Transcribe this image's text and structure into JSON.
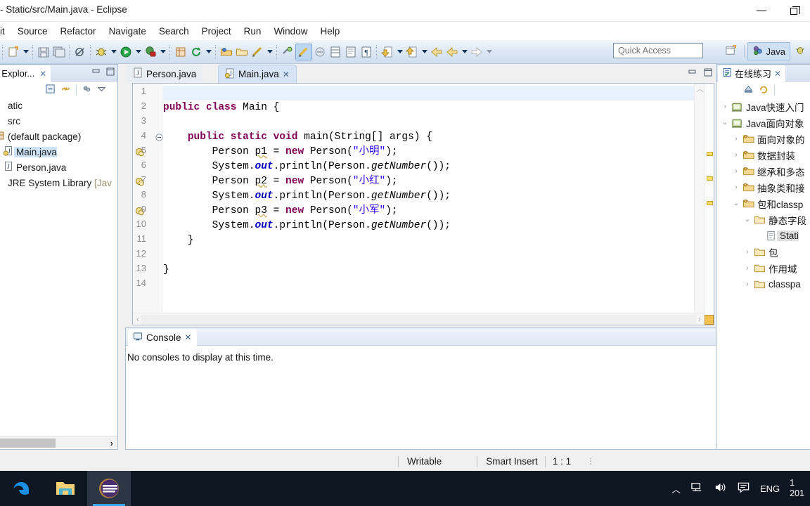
{
  "window": {
    "title": "- Static/src/Main.java - Eclipse",
    "minimize_label": "Minimize",
    "restore_label": "Restore"
  },
  "menubar": {
    "items": [
      {
        "label": "it"
      },
      {
        "label": "Source"
      },
      {
        "label": "Refactor"
      },
      {
        "label": "Navigate"
      },
      {
        "label": "Search"
      },
      {
        "label": "Project"
      },
      {
        "label": "Run"
      },
      {
        "label": "Window"
      },
      {
        "label": "Help"
      }
    ]
  },
  "toolbar": {
    "quick_access_placeholder": "Quick Access",
    "perspective": {
      "open_perspective_label": "",
      "java_label": "Java"
    }
  },
  "package_explorer": {
    "tab_label": "age Explor...",
    "close_label": "✕",
    "tree": [
      {
        "label": "atic",
        "indent": 0,
        "twisty": "",
        "icon": "project-icon",
        "selected": false
      },
      {
        "label": "src",
        "indent": 0,
        "twisty": "",
        "icon": "source-folder-icon",
        "selected": false
      },
      {
        "label": "(default package)",
        "indent": 0,
        "twisty": "",
        "icon": "package-icon",
        "selected": false
      },
      {
        "label": "Main.java",
        "indent": 1,
        "twisty": "›",
        "icon": "java-file-warning-icon",
        "selected": true
      },
      {
        "label": "Person.java",
        "indent": 1,
        "twisty": "›",
        "icon": "java-file-icon",
        "selected": false
      },
      {
        "label": "JRE System Library",
        "suffix": "[Jav",
        "indent": 0,
        "twisty": "",
        "icon": "library-icon",
        "selected": false
      }
    ]
  },
  "editor": {
    "tabs": [
      {
        "label": "Person.java",
        "active": false,
        "closable": false
      },
      {
        "label": "Main.java",
        "active": true,
        "closable": true,
        "close_label": "✕"
      }
    ],
    "lines": [
      {
        "num": "1",
        "warn": false,
        "fold": "",
        "tokens": []
      },
      {
        "num": "2",
        "warn": false,
        "fold": "",
        "tokens": [
          {
            "t": "public",
            "c": "k"
          },
          {
            "t": " ",
            "c": ""
          },
          {
            "t": "class",
            "c": "k"
          },
          {
            "t": " Main {",
            "c": ""
          }
        ]
      },
      {
        "num": "3",
        "warn": false,
        "fold": "",
        "tokens": []
      },
      {
        "num": "4",
        "warn": false,
        "fold": "⊖",
        "tokens": [
          {
            "t": "    ",
            "c": ""
          },
          {
            "t": "public",
            "c": "k"
          },
          {
            "t": " ",
            "c": ""
          },
          {
            "t": "static",
            "c": "k"
          },
          {
            "t": " ",
            "c": ""
          },
          {
            "t": "void",
            "c": "k"
          },
          {
            "t": " main(String[] args) {",
            "c": ""
          }
        ]
      },
      {
        "num": "5",
        "warn": true,
        "fold": "",
        "tokens": [
          {
            "t": "        Person ",
            "c": ""
          },
          {
            "t": "p1",
            "c": "sq"
          },
          {
            "t": " = ",
            "c": ""
          },
          {
            "t": "new",
            "c": "k"
          },
          {
            "t": " Person(",
            "c": ""
          },
          {
            "t": "\"小明\"",
            "c": "s"
          },
          {
            "t": ");",
            "c": ""
          }
        ]
      },
      {
        "num": "6",
        "warn": false,
        "fold": "",
        "tokens": [
          {
            "t": "        System.",
            "c": ""
          },
          {
            "t": "out",
            "c": "fld"
          },
          {
            "t": ".println(Person.",
            "c": ""
          },
          {
            "t": "getNumber",
            "c": "stat"
          },
          {
            "t": "());",
            "c": ""
          }
        ]
      },
      {
        "num": "7",
        "warn": true,
        "fold": "",
        "tokens": [
          {
            "t": "        Person ",
            "c": ""
          },
          {
            "t": "p2",
            "c": "sq"
          },
          {
            "t": " = ",
            "c": ""
          },
          {
            "t": "new",
            "c": "k"
          },
          {
            "t": " Person(",
            "c": ""
          },
          {
            "t": "\"小红\"",
            "c": "s"
          },
          {
            "t": ");",
            "c": ""
          }
        ]
      },
      {
        "num": "8",
        "warn": false,
        "fold": "",
        "tokens": [
          {
            "t": "        System.",
            "c": ""
          },
          {
            "t": "out",
            "c": "fld"
          },
          {
            "t": ".println(Person.",
            "c": ""
          },
          {
            "t": "getNumber",
            "c": "stat"
          },
          {
            "t": "());",
            "c": ""
          }
        ]
      },
      {
        "num": "9",
        "warn": true,
        "fold": "",
        "tokens": [
          {
            "t": "        Person ",
            "c": ""
          },
          {
            "t": "p3",
            "c": "sq"
          },
          {
            "t": " = ",
            "c": ""
          },
          {
            "t": "new",
            "c": "k"
          },
          {
            "t": " Person(",
            "c": ""
          },
          {
            "t": "\"小军\"",
            "c": "s"
          },
          {
            "t": ");",
            "c": ""
          }
        ]
      },
      {
        "num": "10",
        "warn": false,
        "fold": "",
        "tokens": [
          {
            "t": "        System.",
            "c": ""
          },
          {
            "t": "out",
            "c": "fld"
          },
          {
            "t": ".println(Person.",
            "c": ""
          },
          {
            "t": "getNumber",
            "c": "stat"
          },
          {
            "t": "());",
            "c": ""
          }
        ]
      },
      {
        "num": "11",
        "warn": false,
        "fold": "",
        "tokens": [
          {
            "t": "    }",
            "c": ""
          }
        ]
      },
      {
        "num": "12",
        "warn": false,
        "fold": "",
        "tokens": []
      },
      {
        "num": "13",
        "warn": false,
        "fold": "",
        "tokens": [
          {
            "t": "}",
            "c": ""
          }
        ]
      },
      {
        "num": "14",
        "warn": false,
        "fold": "",
        "tokens": []
      }
    ]
  },
  "console": {
    "tab_label": "Console",
    "close_label": "✕",
    "message": "No consoles to display at this time."
  },
  "right_view": {
    "tab_label": "在线练习",
    "close_label": "✕",
    "tree": [
      {
        "label": "Java快速入门",
        "indent": 0,
        "twisty": "›",
        "icon": "course-icon",
        "selected": false
      },
      {
        "label": "Java面向对象",
        "indent": 0,
        "twisty": "⌄",
        "icon": "course-open-icon",
        "selected": false
      },
      {
        "label": "面向对象的",
        "indent": 1,
        "twisty": "›",
        "icon": "chapter-icon",
        "selected": false
      },
      {
        "label": "数据封装",
        "indent": 1,
        "twisty": "›",
        "icon": "chapter-icon",
        "selected": false
      },
      {
        "label": "继承和多态",
        "indent": 1,
        "twisty": "›",
        "icon": "chapter-icon",
        "selected": false
      },
      {
        "label": "抽象类和接",
        "indent": 1,
        "twisty": "›",
        "icon": "chapter-icon",
        "selected": false
      },
      {
        "label": "包和classp",
        "indent": 1,
        "twisty": "⌄",
        "icon": "chapter-open-icon",
        "selected": false
      },
      {
        "label": "静态字段",
        "indent": 2,
        "twisty": "⌄",
        "icon": "folder-open-icon",
        "selected": false
      },
      {
        "label": "Stati",
        "indent": 3,
        "twisty": "",
        "icon": "exercise-icon",
        "selected": true
      },
      {
        "label": "包",
        "indent": 2,
        "twisty": "›",
        "icon": "folder-icon",
        "selected": false
      },
      {
        "label": "作用域",
        "indent": 2,
        "twisty": "›",
        "icon": "folder-icon",
        "selected": false
      },
      {
        "label": "classpa",
        "indent": 2,
        "twisty": "›",
        "icon": "folder-icon",
        "selected": false
      }
    ]
  },
  "statusbar": {
    "writable": "Writable",
    "insert_mode": "Smart Insert",
    "position": "1 : 1"
  },
  "taskbar": {
    "apps": [
      {
        "name": "edge-icon",
        "active": false
      },
      {
        "name": "file-explorer-icon",
        "active": false
      },
      {
        "name": "eclipse-icon",
        "active": true
      }
    ],
    "tray": {
      "show_hidden": "⌃",
      "network": "network-icon",
      "volume": "volume-icon",
      "notifications": "notification-icon",
      "language": "ENG"
    },
    "clock_line1": "1",
    "clock_line2": "201"
  },
  "colors": {
    "keyword": "#7F0055",
    "string": "#2A00FF",
    "field": "#0000C0",
    "accent": "#3BA5F0",
    "selection": "#CDE3F7"
  }
}
